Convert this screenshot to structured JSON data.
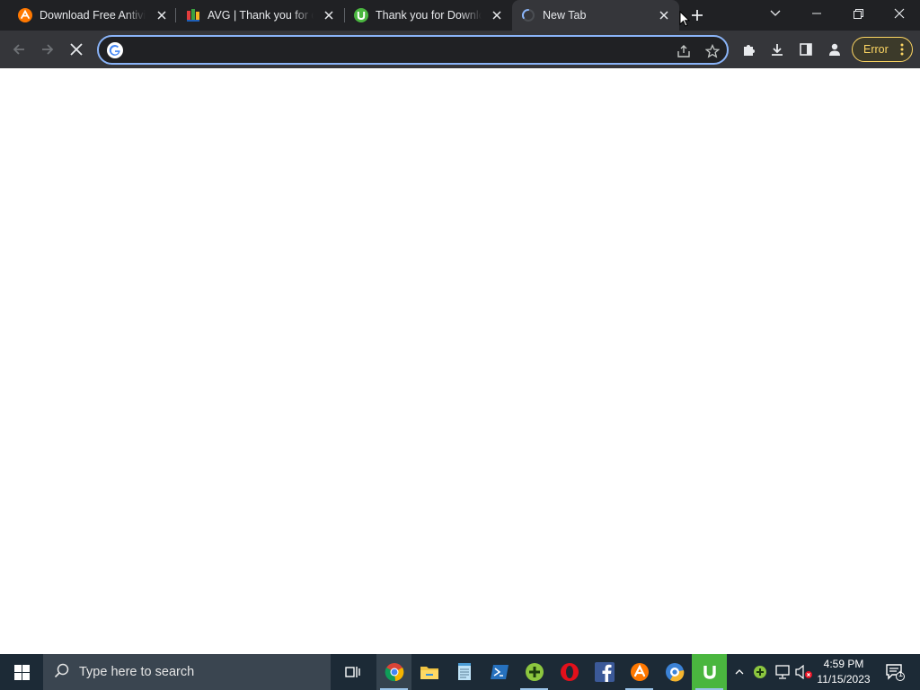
{
  "browser": {
    "tabs": [
      {
        "title": "Download Free Antivir",
        "icon": "avast-icon",
        "active": false
      },
      {
        "title": "AVG | Thank you for do",
        "icon": "avg-icon",
        "active": false
      },
      {
        "title": "Thank you for Downlo",
        "icon": "utorrent-icon",
        "active": false
      },
      {
        "title": "New Tab",
        "icon": "loading-spinner-icon",
        "active": true
      }
    ],
    "omnibox": {
      "value": "",
      "placeholder": ""
    },
    "profile_status": "Error",
    "colors": {
      "frame": "#202124",
      "toolbar": "#35363a",
      "focus_ring": "#8ab4f8",
      "error": "#fdd663"
    }
  },
  "taskbar": {
    "search_placeholder": "Type here to search",
    "apps": [
      "task-view",
      "chrome",
      "file-explorer",
      "notepad",
      "powershell",
      "plus-app",
      "opera",
      "facebook",
      "avast",
      "browser-app",
      "utorrent"
    ],
    "clock": {
      "time": "4:59 PM",
      "date": "11/15/2023"
    },
    "notification_count": "1"
  }
}
